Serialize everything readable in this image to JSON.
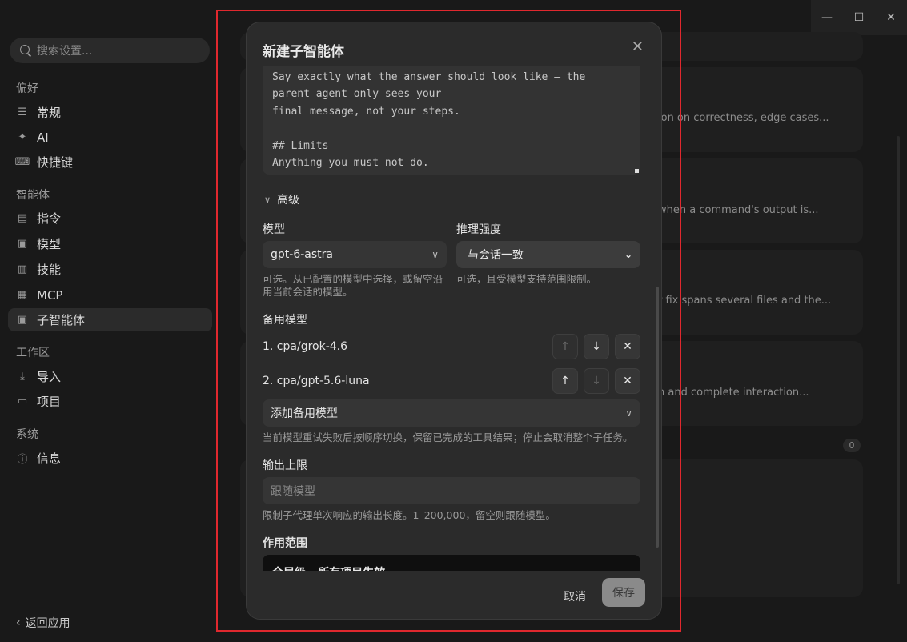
{
  "sidebar": {
    "search_placeholder": "搜索设置...",
    "sections": [
      {
        "title": "偏好",
        "items": [
          {
            "label": "常规",
            "icon": "sliders-icon"
          },
          {
            "label": "AI",
            "icon": "sparkle-icon"
          },
          {
            "label": "快捷键",
            "icon": "keyboard-icon"
          }
        ]
      },
      {
        "title": "智能体",
        "items": [
          {
            "label": "指令",
            "icon": "document-icon"
          },
          {
            "label": "模型",
            "icon": "robot-icon"
          },
          {
            "label": "技能",
            "icon": "book-icon"
          },
          {
            "label": "MCP",
            "icon": "server-icon"
          },
          {
            "label": "子智能体",
            "icon": "robot-icon",
            "active": true
          }
        ]
      },
      {
        "title": "工作区",
        "items": [
          {
            "label": "导入",
            "icon": "download-icon"
          },
          {
            "label": "项目",
            "icon": "archive-icon"
          }
        ]
      },
      {
        "title": "系统",
        "items": [
          {
            "label": "信息",
            "icon": "info-icon"
          }
        ]
      }
    ],
    "back_label": "返回应用"
  },
  "background": {
    "snippets": [
      "ion on correctness, edge cases...",
      "when a command's output is...",
      "r fix spans several files and the...",
      "n and complete interaction..."
    ],
    "count": "0"
  },
  "modal": {
    "title": "新建子智能体",
    "prompt_text": "Say exactly what the answer should look like — the\nparent agent only sees your\nfinal message, not your steps.\n\n## Limits\nAnything you must not do.",
    "advanced_label": "高级",
    "model": {
      "label": "模型",
      "value": "gpt-6-astra",
      "help": "可选。从已配置的模型中选择，或留空沿用当前会话的模型。"
    },
    "reasoning": {
      "label": "推理强度",
      "value": "与会话一致",
      "help": "可选，且受模型支持范围限制。"
    },
    "fallback": {
      "label": "备用模型",
      "items": [
        "1. cpa/grok-4.6",
        "2. cpa/gpt-5.6-luna"
      ],
      "add_label": "添加备用模型",
      "help": "当前模型重试失败后按顺序切换，保留已完成的工具结果；停止会取消整个子任务。"
    },
    "output_limit": {
      "label": "输出上限",
      "placeholder": "跟随模型",
      "help": "限制子代理单次响应的输出长度。1–200,000，留空则跟随模型。"
    },
    "scope": {
      "label": "作用范围",
      "value": "全局级 · 所有项目生效"
    },
    "cancel_label": "取消",
    "save_label": "保存"
  }
}
